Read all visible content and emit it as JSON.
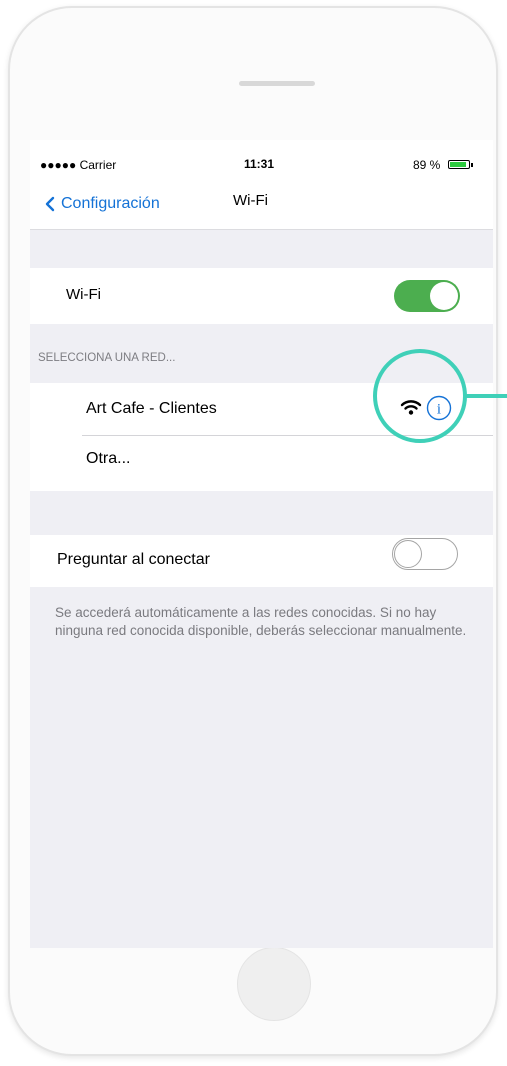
{
  "status_bar": {
    "carrier": "●●●●● Carrier",
    "time": "11:31",
    "battery_percent_label": "89 %",
    "battery_level": 0.89,
    "battery_color": "#2ecc40"
  },
  "nav": {
    "back_label": "Configuración",
    "back_icon": "chevron-left-icon",
    "title": "Wi-Fi",
    "accent_color": "#1472d6"
  },
  "wifi": {
    "label": "Wi-Fi",
    "enabled": true,
    "toggle_on_color": "#4cae4f"
  },
  "networks": {
    "header": "SELECCIONA UNA RED...",
    "items": [
      {
        "name": "Art Cafe - Clientes",
        "icons": [
          "wifi-signal-icon",
          "info-icon"
        ]
      },
      {
        "name": "Otra..."
      }
    ]
  },
  "ask_to_join": {
    "label": "Preguntar al conectar",
    "enabled": false,
    "footnote": "Se accederá automáticamente a las redes conocidas. Si no hay ninguna red conocida disponible, deberás seleccionar manualmente."
  },
  "highlight": {
    "color": "#3fd0b8"
  }
}
